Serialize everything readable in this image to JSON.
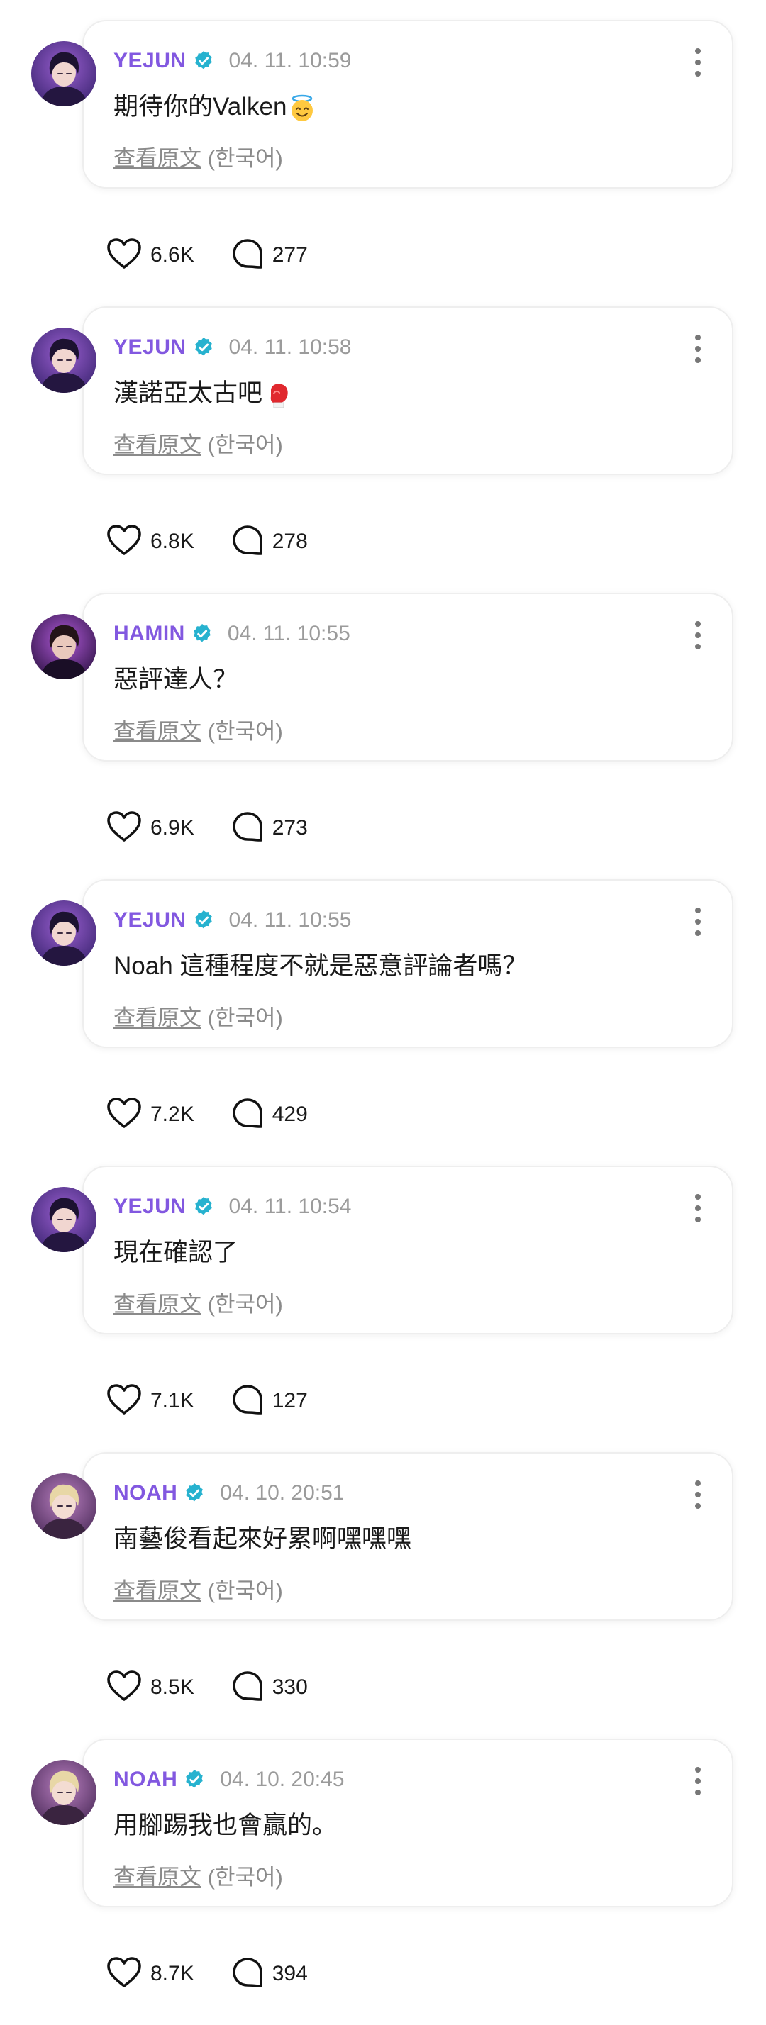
{
  "labels": {
    "view_original": "查看原文",
    "language": "(한국어)"
  },
  "colors": {
    "username": "#8258e0",
    "verified_badge": "#27b2cf",
    "timestamp": "#9b9b9b",
    "translate_text": "#8a8a8a"
  },
  "posts": [
    {
      "user": "YEJUN",
      "avatar": "avatar-yejun",
      "verified": true,
      "time": "04. 11. 10:59",
      "message": "期待你的Valken",
      "emoji": "smiling-face-with-halo-emoji",
      "likes": "6.6K",
      "comments": "277"
    },
    {
      "user": "YEJUN",
      "avatar": "avatar-yejun",
      "verified": true,
      "time": "04. 11. 10:58",
      "message": "漢諾亞太古吧",
      "emoji": "boxing-glove-emoji",
      "likes": "6.8K",
      "comments": "278"
    },
    {
      "user": "HAMIN",
      "avatar": "avatar-hamin",
      "verified": true,
      "time": "04. 11. 10:55",
      "message": "惡評達人？",
      "emoji": "",
      "likes": "6.9K",
      "comments": "273"
    },
    {
      "user": "YEJUN",
      "avatar": "avatar-yejun",
      "verified": true,
      "time": "04. 11. 10:55",
      "message": "Noah 這種程度不就是惡意評論者嗎？",
      "emoji": "",
      "likes": "7.2K",
      "comments": "429"
    },
    {
      "user": "YEJUN",
      "avatar": "avatar-yejun",
      "verified": true,
      "time": "04. 11. 10:54",
      "message": "現在確認了",
      "emoji": "",
      "likes": "7.1K",
      "comments": "127"
    },
    {
      "user": "NOAH",
      "avatar": "avatar-noah",
      "verified": true,
      "time": "04. 10. 20:51",
      "message": "南藝俊看起來好累啊嘿嘿嘿",
      "emoji": "",
      "likes": "8.5K",
      "comments": "330"
    },
    {
      "user": "NOAH",
      "avatar": "avatar-noah",
      "verified": true,
      "time": "04. 10. 20:45",
      "message": "用腳踢我也會贏的。",
      "emoji": "",
      "likes": "8.7K",
      "comments": "394"
    }
  ]
}
